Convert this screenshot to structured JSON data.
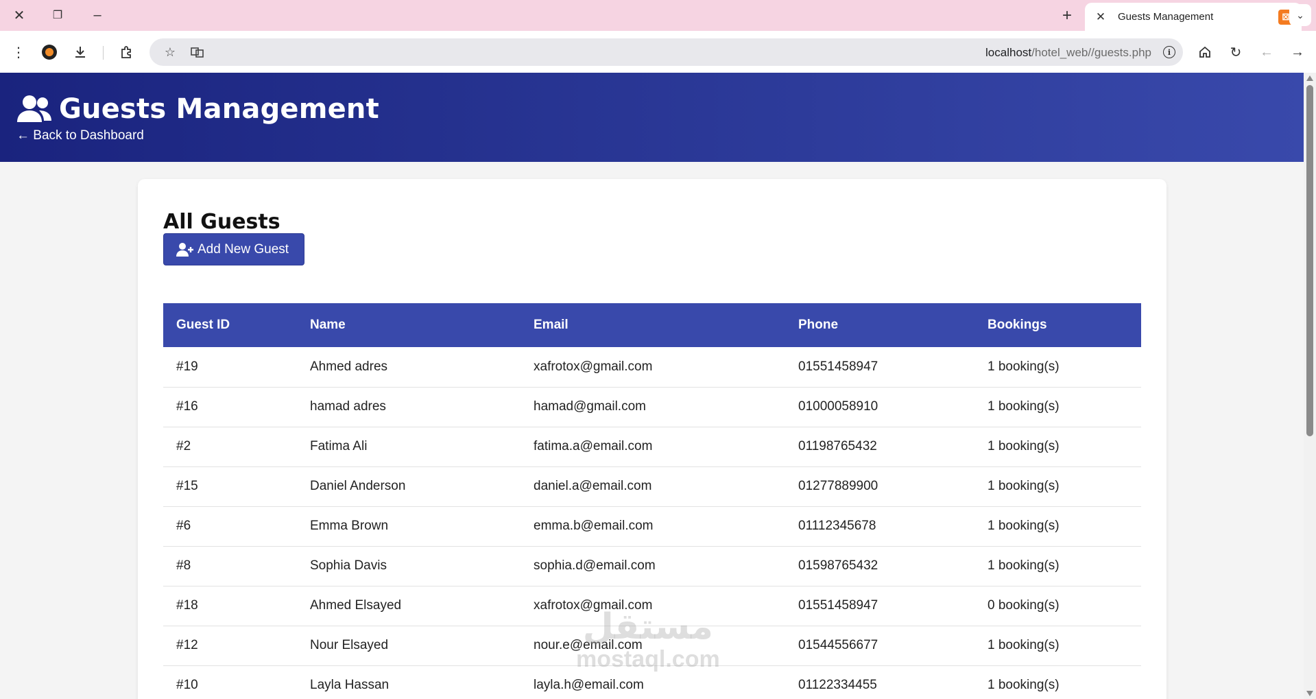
{
  "browser": {
    "tab_title": "Guests Management",
    "url_host": "localhost",
    "url_path": "/hotel_web//guests.php"
  },
  "header": {
    "title": "Guests Management",
    "back_link": "← Back to Dashboard"
  },
  "card": {
    "title": "All Guests",
    "add_button": "Add New Guest"
  },
  "table": {
    "columns": [
      "Guest ID",
      "Name",
      "Email",
      "Phone",
      "Bookings"
    ],
    "rows": [
      {
        "id": "#19",
        "name": "Ahmed adres",
        "email": "xafrotox@gmail.com",
        "phone": "01551458947",
        "bookings": "1 booking(s)"
      },
      {
        "id": "#16",
        "name": "hamad adres",
        "email": "hamad@gmail.com",
        "phone": "01000058910",
        "bookings": "1 booking(s)"
      },
      {
        "id": "#2",
        "name": "Fatima Ali",
        "email": "fatima.a@email.com",
        "phone": "01198765432",
        "bookings": "1 booking(s)"
      },
      {
        "id": "#15",
        "name": "Daniel Anderson",
        "email": "daniel.a@email.com",
        "phone": "01277889900",
        "bookings": "1 booking(s)"
      },
      {
        "id": "#6",
        "name": "Emma Brown",
        "email": "emma.b@email.com",
        "phone": "01112345678",
        "bookings": "1 booking(s)"
      },
      {
        "id": "#8",
        "name": "Sophia Davis",
        "email": "sophia.d@email.com",
        "phone": "01598765432",
        "bookings": "1 booking(s)"
      },
      {
        "id": "#18",
        "name": "Ahmed Elsayed",
        "email": "xafrotox@gmail.com",
        "phone": "01551458947",
        "bookings": "0 booking(s)"
      },
      {
        "id": "#12",
        "name": "Nour Elsayed",
        "email": "nour.e@email.com",
        "phone": "01544556677",
        "bookings": "1 booking(s)"
      },
      {
        "id": "#10",
        "name": "Layla Hassan",
        "email": "layla.h@email.com",
        "phone": "01122334455",
        "bookings": "1 booking(s)"
      }
    ]
  },
  "watermark": {
    "line1": "مستقل",
    "line2": "mostaql.com"
  },
  "icons": {
    "users": "users-icon",
    "add_user": "user-plus-icon"
  },
  "colors": {
    "header_start": "#1a237e",
    "header_end": "#3949ab",
    "accent": "#3949ab"
  }
}
